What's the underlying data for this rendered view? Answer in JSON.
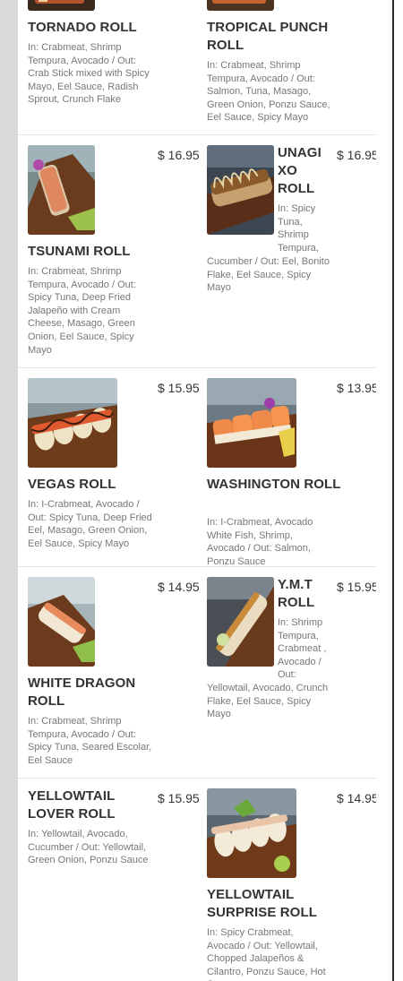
{
  "menu": {
    "rows": [
      {
        "left": {
          "name": "TORNADO ROLL",
          "desc": "In: Crabmeat, Shrimp Tempura, Avocado / Out: Crab Stick mixed with Spicy Mayo, Eel Sauce, Radish Sprout, Crunch Flake"
        },
        "right": {
          "name": "TROPICAL PUNCH ROLL",
          "desc": "In: Crabmeat, Shrimp Tempura, Avocado / Out: Salmon, Tuna, Masago, Green Onion, Ponzu Sauce, Eel Sauce, Spicy Mayo"
        }
      },
      {
        "left": {
          "name": "TSUNAMI ROLL",
          "price": "$ 16.95",
          "desc": "In: Crabmeat, Shrimp Tempura, Avocado / Out: Spicy Tuna, Deep Fried Jalapeño with Cream Cheese, Masago, Green Onion, Eel Sauce, Spicy Mayo"
        },
        "right": {
          "name": "UNAGI XO ROLL",
          "price": "$ 16.95",
          "desc_top": "In: Spicy Tuna, Shrimp Tempura,",
          "desc_bottom": "Cucumber / Out: Eel, Bonito Flake, Eel Sauce, Spicy Mayo"
        }
      },
      {
        "left": {
          "name": "VEGAS ROLL",
          "price": "$ 15.95",
          "desc": "In: I-Crabmeat, Avocado / Out: Spicy Tuna, Deep Fried Eel, Masago, Green Onion, Eel Sauce, Spicy Mayo"
        },
        "right": {
          "name": "WASHINGTON ROLL",
          "price": "$ 13.95",
          "desc": "In: I-Crabmeat, Avocado White Fish, Shrimp, Avocado / Out: Salmon, Ponzu Sauce"
        }
      },
      {
        "left": {
          "name": "WHITE DRAGON ROLL",
          "price": "$ 14.95",
          "desc": "In: Crabmeat, Shrimp Tempura, Avocado / Out: Spicy Tuna, Seared Escolar, Eel Sauce"
        },
        "right": {
          "name": "Y.M.T ROLL",
          "price": "$ 15.95",
          "desc_top": "In: Shrimp Tempura, Crabmeat , Avocado / Out:",
          "desc_bottom": "Yellowtail, Avocado, Crunch Flake, Eel Sauce, Spicy Mayo"
        }
      },
      {
        "left": {
          "name": "YELLOWTAIL LOVER ROLL",
          "price": "$ 15.95",
          "desc": "In: Yellowtail, Avocado, Cucumber / Out: Yellowtail, Green Onion, Ponzu Sauce"
        },
        "right": {
          "name": "YELLOWTAIL SURPRISE ROLL",
          "price": "$ 14.95",
          "desc": "In: Spicy Crabmeat, Avocado / Out: Yellowtail, Chopped Jalapeños & Cilantro, Ponzu Sauce, Hot Sauce"
        }
      }
    ]
  }
}
